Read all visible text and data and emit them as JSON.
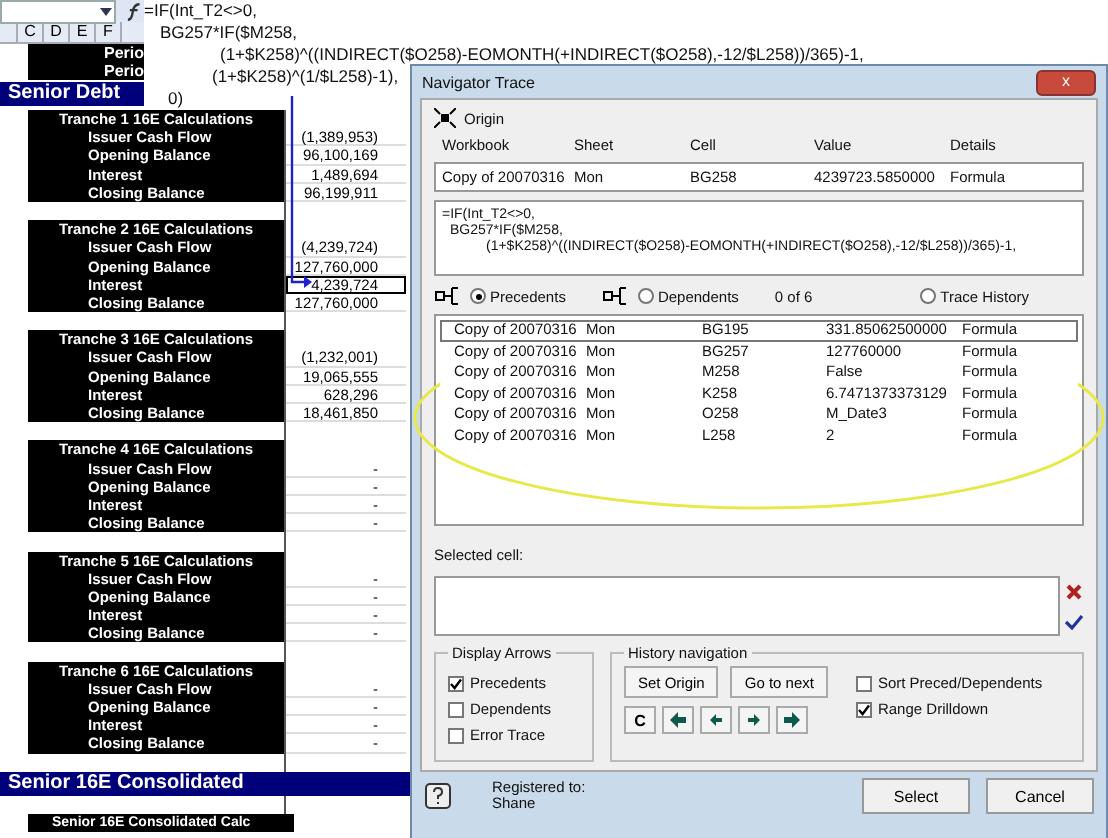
{
  "formula_bar": {
    "lines": [
      "=IF(Int_T2<>0,",
      "BG257*IF($M258,",
      "(1+$K258)^((INDIRECT($O258)-EOMONTH(+INDIRECT($O258),-12/$L258))/365)-1,",
      "(1+$K258)^(1/$L258)-1),",
      "0)"
    ]
  },
  "column_headers": [
    "C",
    "D",
    "E",
    "F"
  ],
  "top_rows": [
    "Perio",
    "Perio"
  ],
  "section_title": "Senior Debt",
  "tranches": [
    {
      "title": "Tranche 1 16E Calculations",
      "rows": [
        {
          "label": "Issuer Cash Flow",
          "value": "(1,389,953)",
          "selected": false
        },
        {
          "label": "Opening Balance",
          "value": "96,100,169",
          "selected": false
        },
        {
          "label": "Interest",
          "value": "1,489,694",
          "selected": false
        },
        {
          "label": "Closing Balance",
          "value": "96,199,911",
          "selected": false
        }
      ]
    },
    {
      "title": "Tranche 2 16E Calculations",
      "rows": [
        {
          "label": "Issuer Cash Flow",
          "value": "(4,239,724)",
          "selected": false
        },
        {
          "label": "Opening Balance",
          "value": "127,760,000",
          "selected": false
        },
        {
          "label": "Interest",
          "value": "4,239,724",
          "selected": true
        },
        {
          "label": "Closing Balance",
          "value": "127,760,000",
          "selected": false
        }
      ]
    },
    {
      "title": "Tranche 3 16E Calculations",
      "rows": [
        {
          "label": "Issuer Cash Flow",
          "value": "(1,232,001)",
          "selected": false
        },
        {
          "label": "Opening Balance",
          "value": "19,065,555",
          "selected": false
        },
        {
          "label": "Interest",
          "value": "628,296",
          "selected": false
        },
        {
          "label": "Closing Balance",
          "value": "18,461,850",
          "selected": false
        }
      ]
    },
    {
      "title": "Tranche 4 16E Calculations",
      "rows": [
        {
          "label": "Issuer Cash Flow",
          "value": "-",
          "selected": false
        },
        {
          "label": "Opening Balance",
          "value": "-",
          "selected": false
        },
        {
          "label": "Interest",
          "value": "-",
          "selected": false
        },
        {
          "label": "Closing Balance",
          "value": "-",
          "selected": false
        }
      ]
    },
    {
      "title": "Tranche 5 16E Calculations",
      "rows": [
        {
          "label": "Issuer Cash Flow",
          "value": "-",
          "selected": false
        },
        {
          "label": "Opening Balance",
          "value": "-",
          "selected": false
        },
        {
          "label": "Interest",
          "value": "-",
          "selected": false
        },
        {
          "label": "Closing Balance",
          "value": "-",
          "selected": false
        }
      ]
    },
    {
      "title": "Tranche 6 16E Calculations",
      "rows": [
        {
          "label": "Issuer Cash Flow",
          "value": "-",
          "selected": false
        },
        {
          "label": "Opening Balance",
          "value": "-",
          "selected": false
        },
        {
          "label": "Interest",
          "value": "-",
          "selected": false
        },
        {
          "label": "Closing Balance",
          "value": "-",
          "selected": false
        }
      ]
    }
  ],
  "consolidated": {
    "title": "Senior 16E Consolidated",
    "sub": "Senior 16E Consolidated Calc"
  },
  "dialog": {
    "title": "Navigator Trace",
    "close": "x",
    "origin_label": "Origin",
    "columns": [
      "Workbook",
      "Sheet",
      "Cell",
      "Value",
      "Details"
    ],
    "origin": [
      "Copy of 20070316",
      "Mon",
      "BG258",
      "4239723.5850000",
      "Formula"
    ],
    "formula": [
      "=IF(Int_T2<>0,",
      "BG257*IF($M258,",
      "(1+$K258)^((INDIRECT($O258)-EOMONTH(+INDIRECT($O258),-12/$L258))/365)-1,"
    ],
    "modes": [
      {
        "label": "Precedents",
        "selected": true
      },
      {
        "label": "Dependents",
        "selected": false
      }
    ],
    "count": "0 of 6",
    "trace_history": {
      "label": "Trace History",
      "selected": false
    },
    "results": [
      {
        "cells": [
          "Copy of 20070316",
          "Mon",
          "BG195",
          "331.85062500000",
          "Formula"
        ],
        "selected": true
      },
      {
        "cells": [
          "Copy of 20070316",
          "Mon",
          "BG257",
          "127760000",
          "Formula"
        ],
        "selected": false
      },
      {
        "cells": [
          "Copy of 20070316",
          "Mon",
          "M258",
          "False",
          "Formula"
        ],
        "selected": false
      },
      {
        "cells": [
          "Copy of 20070316",
          "Mon",
          "K258",
          "6.7471373373129",
          "Formula"
        ],
        "selected": false
      },
      {
        "cells": [
          "Copy of 20070316",
          "Mon",
          "O258",
          "M_Date3",
          "Formula"
        ],
        "selected": false
      },
      {
        "cells": [
          "Copy of 20070316",
          "Mon",
          "L258",
          "2",
          "Formula"
        ],
        "selected": false
      }
    ],
    "selected_cell_label": "Selected cell:",
    "display_arrows": {
      "title": "Display Arrows",
      "options": [
        {
          "label": "Precedents",
          "checked": true
        },
        {
          "label": "Dependents",
          "checked": false
        },
        {
          "label": "Error Trace",
          "checked": false
        }
      ]
    },
    "history": {
      "title": "History navigation",
      "buttons": [
        "Set Origin",
        "Go to next"
      ],
      "clear": "C"
    },
    "options": [
      {
        "label": "Sort Preced/Dependents",
        "checked": false
      },
      {
        "label": "Range Drilldown",
        "checked": true
      }
    ],
    "registered": [
      "Registered to:",
      "Shane"
    ],
    "buttons": [
      "Select",
      "Cancel"
    ]
  }
}
